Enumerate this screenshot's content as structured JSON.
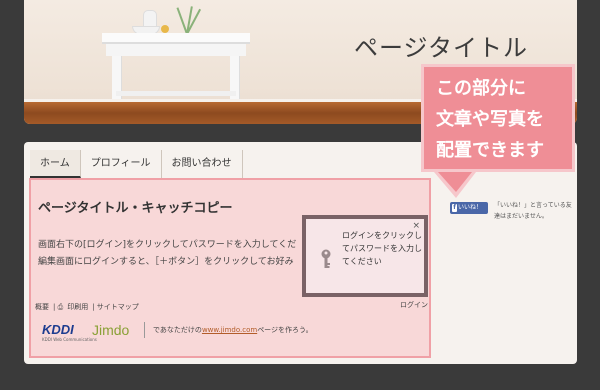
{
  "header": {
    "title": "ページタイトル"
  },
  "nav": {
    "tabs": [
      "ホーム",
      "プロフィール",
      "お問い合わせ"
    ]
  },
  "content": {
    "catch_copy": "ページタイトル・キャッチコピー",
    "body_line1": "画面右下の[ログイン]をクリックしてパスワードを入力してくだ",
    "body_line2": "編集画面にログインすると、［＋ボタン］をクリックしてお好み"
  },
  "footer": {
    "links": [
      "概要",
      "印刷用",
      "サイトマップ"
    ],
    "login": "ログイン",
    "kddi": "KDDI",
    "kddi_sub": "KDDI Web Communications",
    "jimdo": "Jimdo",
    "jimdo_pre": "であなただけの",
    "jimdo_link": "www.jimdo.com",
    "jimdo_post": "ページを作ろう。"
  },
  "login_popup": {
    "close": "×",
    "text": "ログインをクリックしてパスワードを入力してください"
  },
  "facebook": {
    "like_label": "いいね！",
    "text": "「いいね！」と言っている友達はまだいません。"
  },
  "callout": {
    "lines": [
      "この部分に",
      "文章や写真を",
      "配置できます"
    ]
  }
}
